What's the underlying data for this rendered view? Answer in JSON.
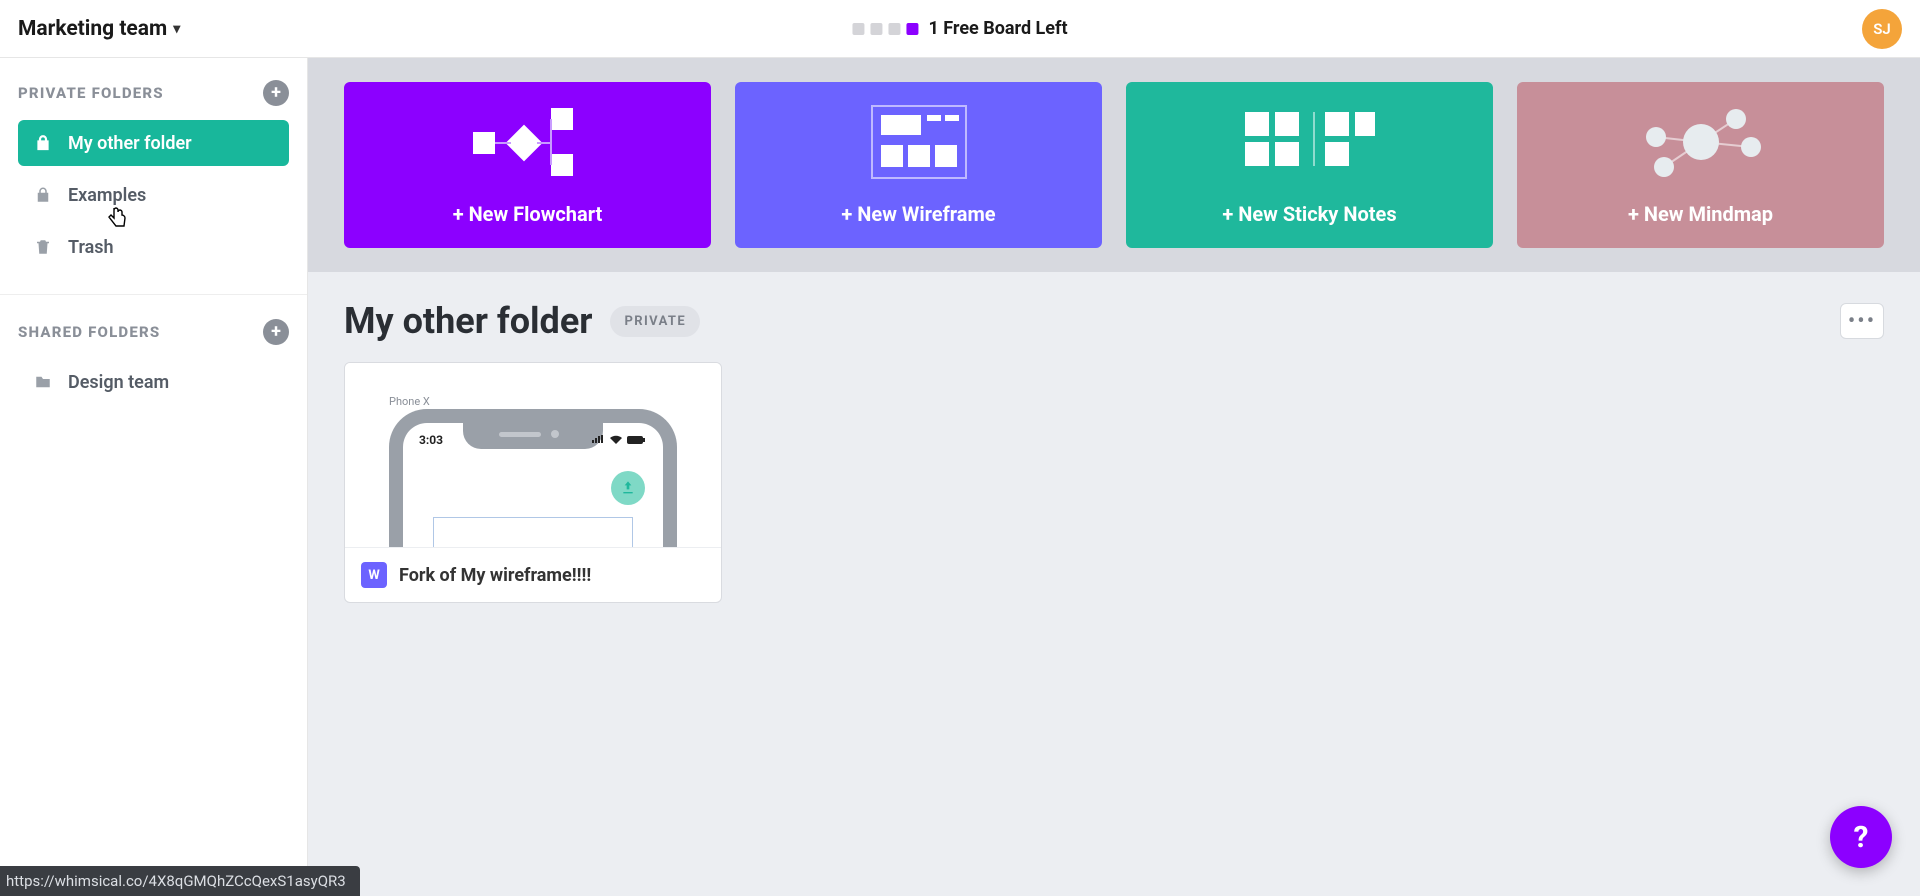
{
  "header": {
    "team_name": "Marketing team",
    "boards_remaining_label": "1 Free Board Left",
    "avatar_initials": "SJ"
  },
  "sidebar": {
    "private": {
      "section_label": "PRIVATE FOLDERS",
      "items": [
        {
          "label": "My other folder",
          "icon": "lock",
          "active": true
        },
        {
          "label": "Examples",
          "icon": "lock",
          "active": false
        },
        {
          "label": "Trash",
          "icon": "trash",
          "active": false
        }
      ]
    },
    "shared": {
      "section_label": "SHARED FOLDERS",
      "items": [
        {
          "label": "Design team",
          "icon": "folder",
          "active": false
        }
      ]
    }
  },
  "create_cards": {
    "flowchart": "+ New Flowchart",
    "wireframe": "+ New Wireframe",
    "sticky": "+ New Sticky Notes",
    "mindmap": "+ New Mindmap"
  },
  "folder_view": {
    "title": "My other folder",
    "badge": "PRIVATE",
    "boards": [
      {
        "title": "Fork of My wireframe!!!!",
        "type_initial": "W",
        "preview_label": "Phone X",
        "preview_time": "3:03"
      }
    ]
  },
  "status_url": "https://whimsical.co/4X8qGMQhZCcQexS1asyQR3",
  "help_label": "?"
}
